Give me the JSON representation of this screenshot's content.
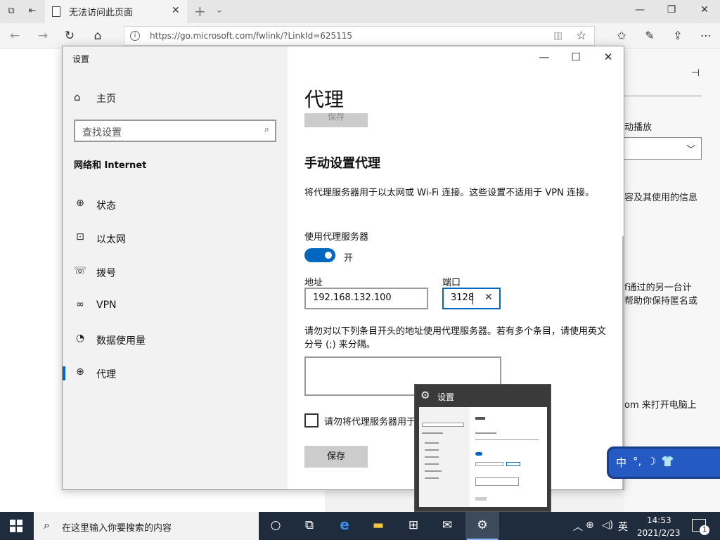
{
  "browser": {
    "tab_title": "无法访问此页面",
    "url": "https://go.microsoft.com/fwlink/?LinkId=625115"
  },
  "background_page": {
    "text_autoplay": "动播放",
    "text_info": "容及其使用的信息",
    "text_other_1": "f通过的另一台计",
    "text_other_2": "帮助你保持匿名或",
    "text_com": "om 来打开电脑上"
  },
  "settings": {
    "window_title": "设置",
    "home_label": "主页",
    "search_placeholder": "查找设置",
    "section_title": "网络和 Internet",
    "nav": [
      {
        "label": "状态",
        "icon": "globe-icon"
      },
      {
        "label": "以太网",
        "icon": "ethernet-icon"
      },
      {
        "label": "拨号",
        "icon": "dialup-icon"
      },
      {
        "label": "VPN",
        "icon": "vpn-icon"
      },
      {
        "label": "数据使用量",
        "icon": "data-usage-icon"
      },
      {
        "label": "代理",
        "icon": "proxy-globe-icon"
      }
    ],
    "active_nav": "代理",
    "page_title": "代理",
    "faded_save_label": "保存",
    "manual_heading": "手动设置代理",
    "manual_desc": "将代理服务器用于以太网或 Wi-Fi 连接。这些设置不适用于 VPN 连接。",
    "use_proxy_label": "使用代理服务器",
    "toggle_state_label": "开",
    "address_label": "地址",
    "address_value": "192.168.132.100",
    "port_label": "端口",
    "port_value": "3128",
    "exceptions_desc": "请勿对以下列条目开头的地址使用代理服务器。若有多个条目，请使用英文分号 (;) 来分隔。",
    "exceptions_value": "",
    "local_checkbox_label": "请勿将代理服务器用于本地(Intranet)地址",
    "save_label": "保存"
  },
  "preview": {
    "title": "设置"
  },
  "ime": {
    "mode": "中"
  },
  "taskbar": {
    "search_placeholder": "在这里输入你要搜索的内容",
    "lang": "英",
    "time": "14:53",
    "date": "2021/2/23",
    "notification_count": "1"
  },
  "colors": {
    "accent": "#0067c0",
    "taskbar": "#1f2c3e"
  }
}
